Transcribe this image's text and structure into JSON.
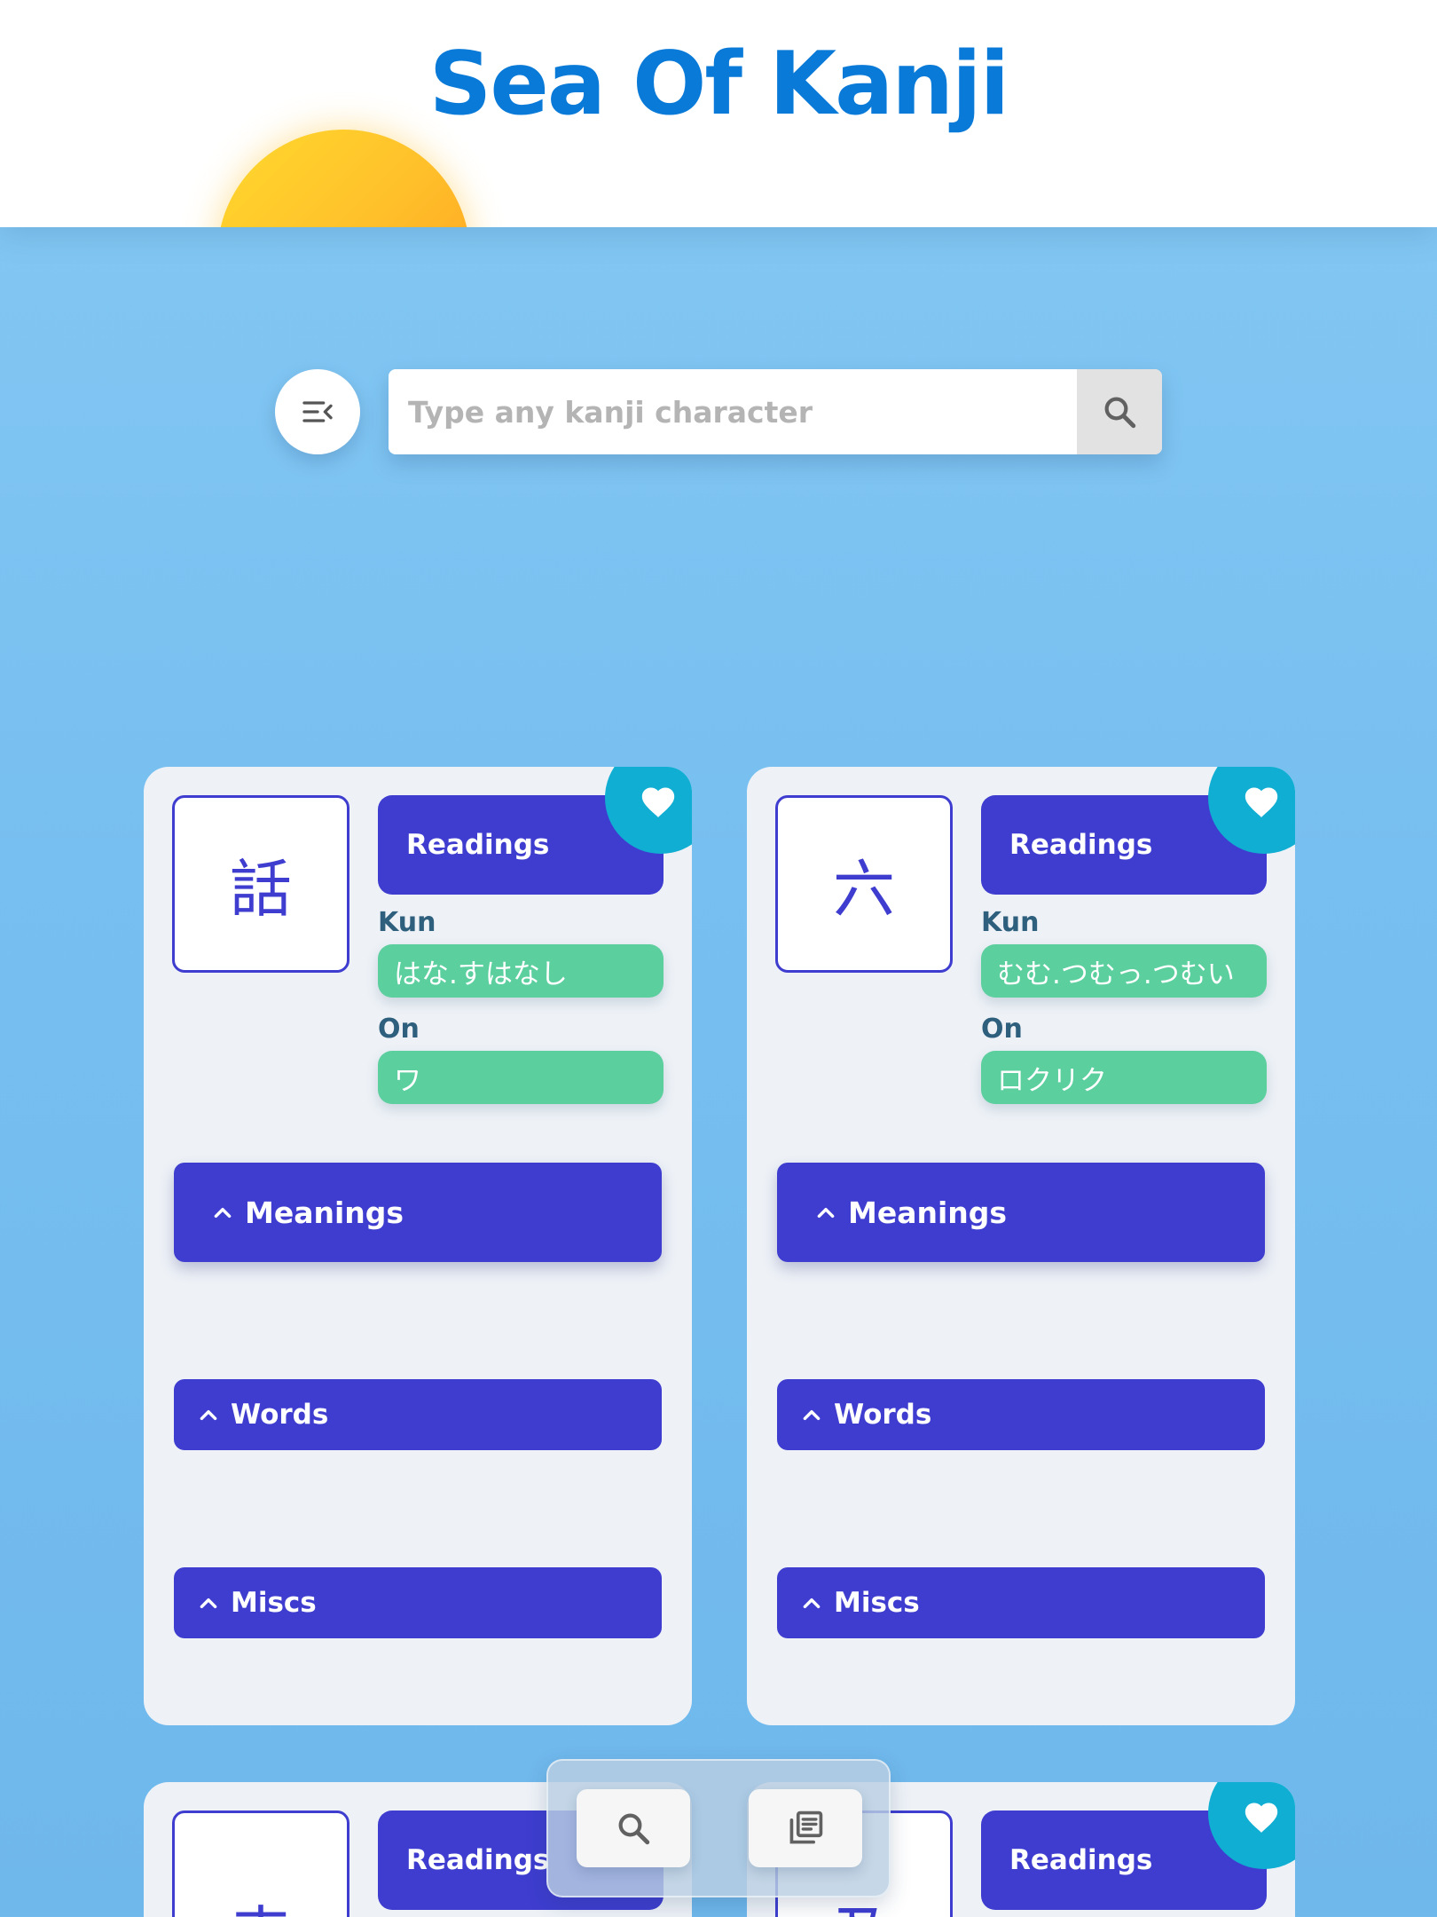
{
  "header": {
    "title": "Sea Of Kanji"
  },
  "search": {
    "placeholder": "Type any kanji character",
    "value": ""
  },
  "icons": {
    "menu": "menu-collapse-icon",
    "search": "search-icon",
    "favorite": "heart-icon",
    "chevron": "chevron-up-icon",
    "list": "library-books-icon"
  },
  "colors": {
    "title": "#0a7ad8",
    "primary": "#3e3dcf",
    "pill": "#5ccf9e",
    "favorite": "#10aed3",
    "card": "#eef2f7"
  },
  "labels": {
    "readings": "Readings",
    "kun": "Kun",
    "on": "On",
    "meanings": "Meanings",
    "words": "Words",
    "miscs": "Miscs"
  },
  "cards": [
    {
      "kanji": "話",
      "kun": "はな.すはなし",
      "on": "ワ",
      "favorite": true
    },
    {
      "kanji": "六",
      "kun": "むむ.つむっ.つむい",
      "on": "ロクリク",
      "favorite": true
    },
    {
      "kanji": "来",
      "kun": "",
      "on": "",
      "favorite": false
    },
    {
      "kanji": "及",
      "kun": "",
      "on": "",
      "favorite": true
    }
  ]
}
